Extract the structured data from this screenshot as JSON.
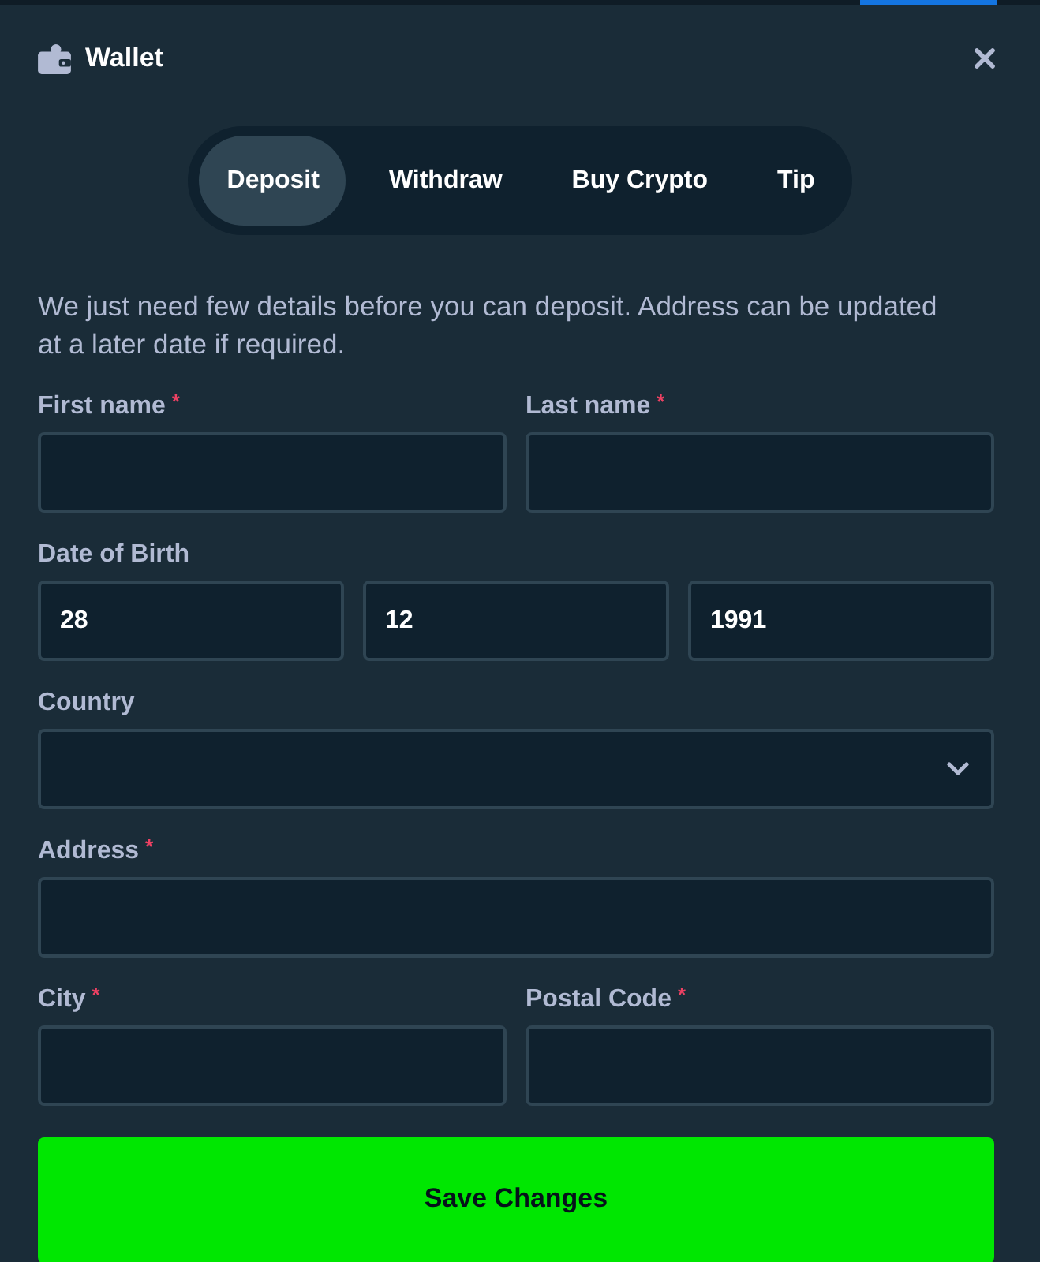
{
  "window": {
    "title": "Wallet"
  },
  "tabs": [
    {
      "label": "Deposit",
      "selected": true
    },
    {
      "label": "Withdraw",
      "selected": false
    },
    {
      "label": "Buy Crypto",
      "selected": false
    },
    {
      "label": "Tip",
      "selected": false
    }
  ],
  "description": "We just need few details before you can deposit. Address can be updated at a later date if required.",
  "form": {
    "rows": [
      {
        "fields": [
          {
            "kind": "text",
            "label": "First name",
            "required_mark": "*"
          },
          {
            "kind": "text",
            "label": "Last name",
            "required_mark": "*"
          }
        ]
      },
      {
        "fields": [
          {
            "kind": "date",
            "label": "Date of Birth",
            "values": [
              "28",
              "12",
              "1991"
            ]
          }
        ]
      },
      {
        "fields": [
          {
            "kind": "select",
            "label": "Country"
          }
        ]
      },
      {
        "fields": [
          {
            "kind": "text",
            "label": "Address",
            "required_mark": "*"
          }
        ]
      },
      {
        "fields": [
          {
            "kind": "text",
            "label": "City",
            "required_mark": "*"
          },
          {
            "kind": "text",
            "label": "Postal Code",
            "required_mark": "*"
          }
        ]
      }
    ]
  },
  "submit_button": {
    "label": "Save Changes"
  }
}
